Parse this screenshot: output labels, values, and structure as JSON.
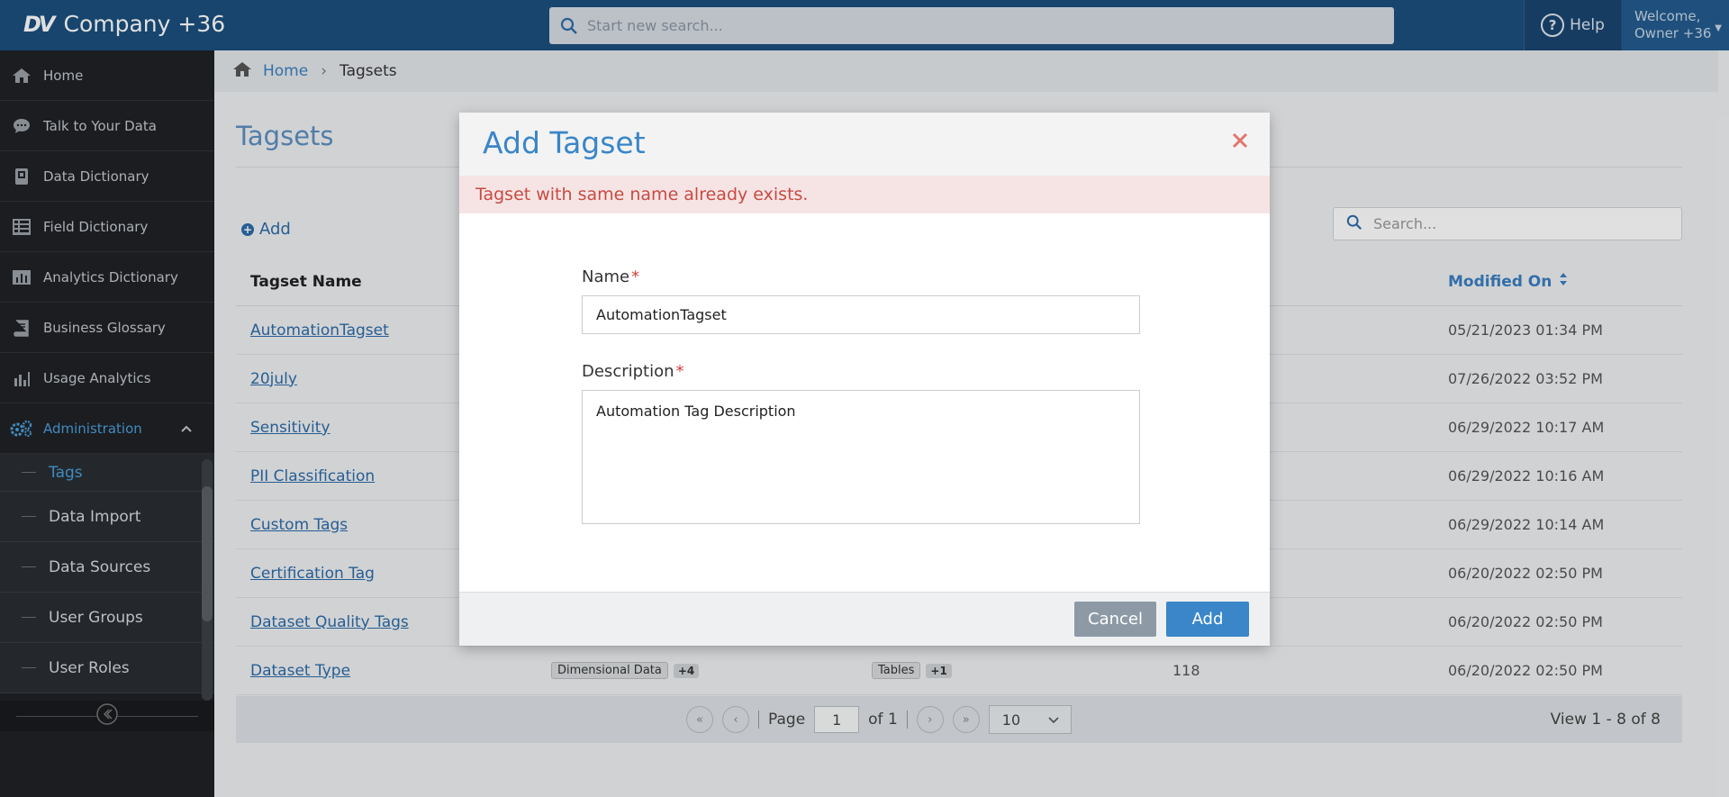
{
  "app": {
    "logo_mark": "DV",
    "company": "Company +36",
    "search_placeholder": "Start new search...",
    "help_label": "Help",
    "welcome_line1": "Welcome,",
    "welcome_line2": "Owner +36"
  },
  "sidebar": {
    "items": [
      {
        "label": "Home",
        "icon": "home-icon"
      },
      {
        "label": "Talk to Your Data",
        "icon": "chat-icon"
      },
      {
        "label": "Data Dictionary",
        "icon": "book-icon"
      },
      {
        "label": "Field Dictionary",
        "icon": "table-icon"
      },
      {
        "label": "Analytics Dictionary",
        "icon": "bar-chart-icon"
      },
      {
        "label": "Business Glossary",
        "icon": "glossary-icon"
      },
      {
        "label": "Usage Analytics",
        "icon": "analytics-icon"
      },
      {
        "label": "Administration",
        "icon": "gears-icon"
      }
    ],
    "sub_items": [
      {
        "label": "Tags"
      },
      {
        "label": "Data Import"
      },
      {
        "label": "Data Sources"
      },
      {
        "label": "User Groups"
      },
      {
        "label": "User Roles"
      }
    ]
  },
  "breadcrumb": {
    "home": "Home",
    "current": "Tagsets"
  },
  "page": {
    "title": "Tagsets",
    "add_label": "Add",
    "search_placeholder": "Search..."
  },
  "table": {
    "headers": {
      "name": "Tagset Name",
      "modified": "Modified On"
    },
    "rows": [
      {
        "name": "AutomationTagset",
        "modified": "05/21/2023 01:34 PM"
      },
      {
        "name": "20july",
        "modified": "07/26/2022 03:52 PM"
      },
      {
        "name": "Sensitivity",
        "modified": "06/29/2022 10:17 AM"
      },
      {
        "name": "PII Classification",
        "modified": "06/29/2022 10:16 AM"
      },
      {
        "name": "Custom Tags",
        "modified": "06/29/2022 10:14 AM"
      },
      {
        "name": "Certification Tag",
        "modified": "06/20/2022 02:50 PM"
      },
      {
        "name": "Dataset Quality Tags",
        "modified": "06/20/2022 02:50 PM"
      },
      {
        "name": "Dataset Type",
        "modified": "06/20/2022 02:50 PM",
        "tag1": "Dimensional Data",
        "tag1_more": "+4",
        "tag2": "Tables",
        "tag2_more": "+1",
        "count": "118"
      }
    ]
  },
  "pager": {
    "page_label": "Page",
    "page_value": "1",
    "of_label": "of 1",
    "page_size": "10",
    "view_text": "View 1 - 8 of 8"
  },
  "modal": {
    "title": "Add Tagset",
    "error": "Tagset with same name already exists.",
    "name_label": "Name",
    "name_value": "AutomationTagset",
    "required_mark": "*",
    "description_label": "Description",
    "description_value": "Automation Tag Description",
    "cancel_label": "Cancel",
    "add_label": "Add"
  },
  "colors": {
    "topbar": "#1b4f7e",
    "accent": "#3a86c8",
    "error_text": "#c84a43",
    "sidebar": "#1f2226"
  }
}
